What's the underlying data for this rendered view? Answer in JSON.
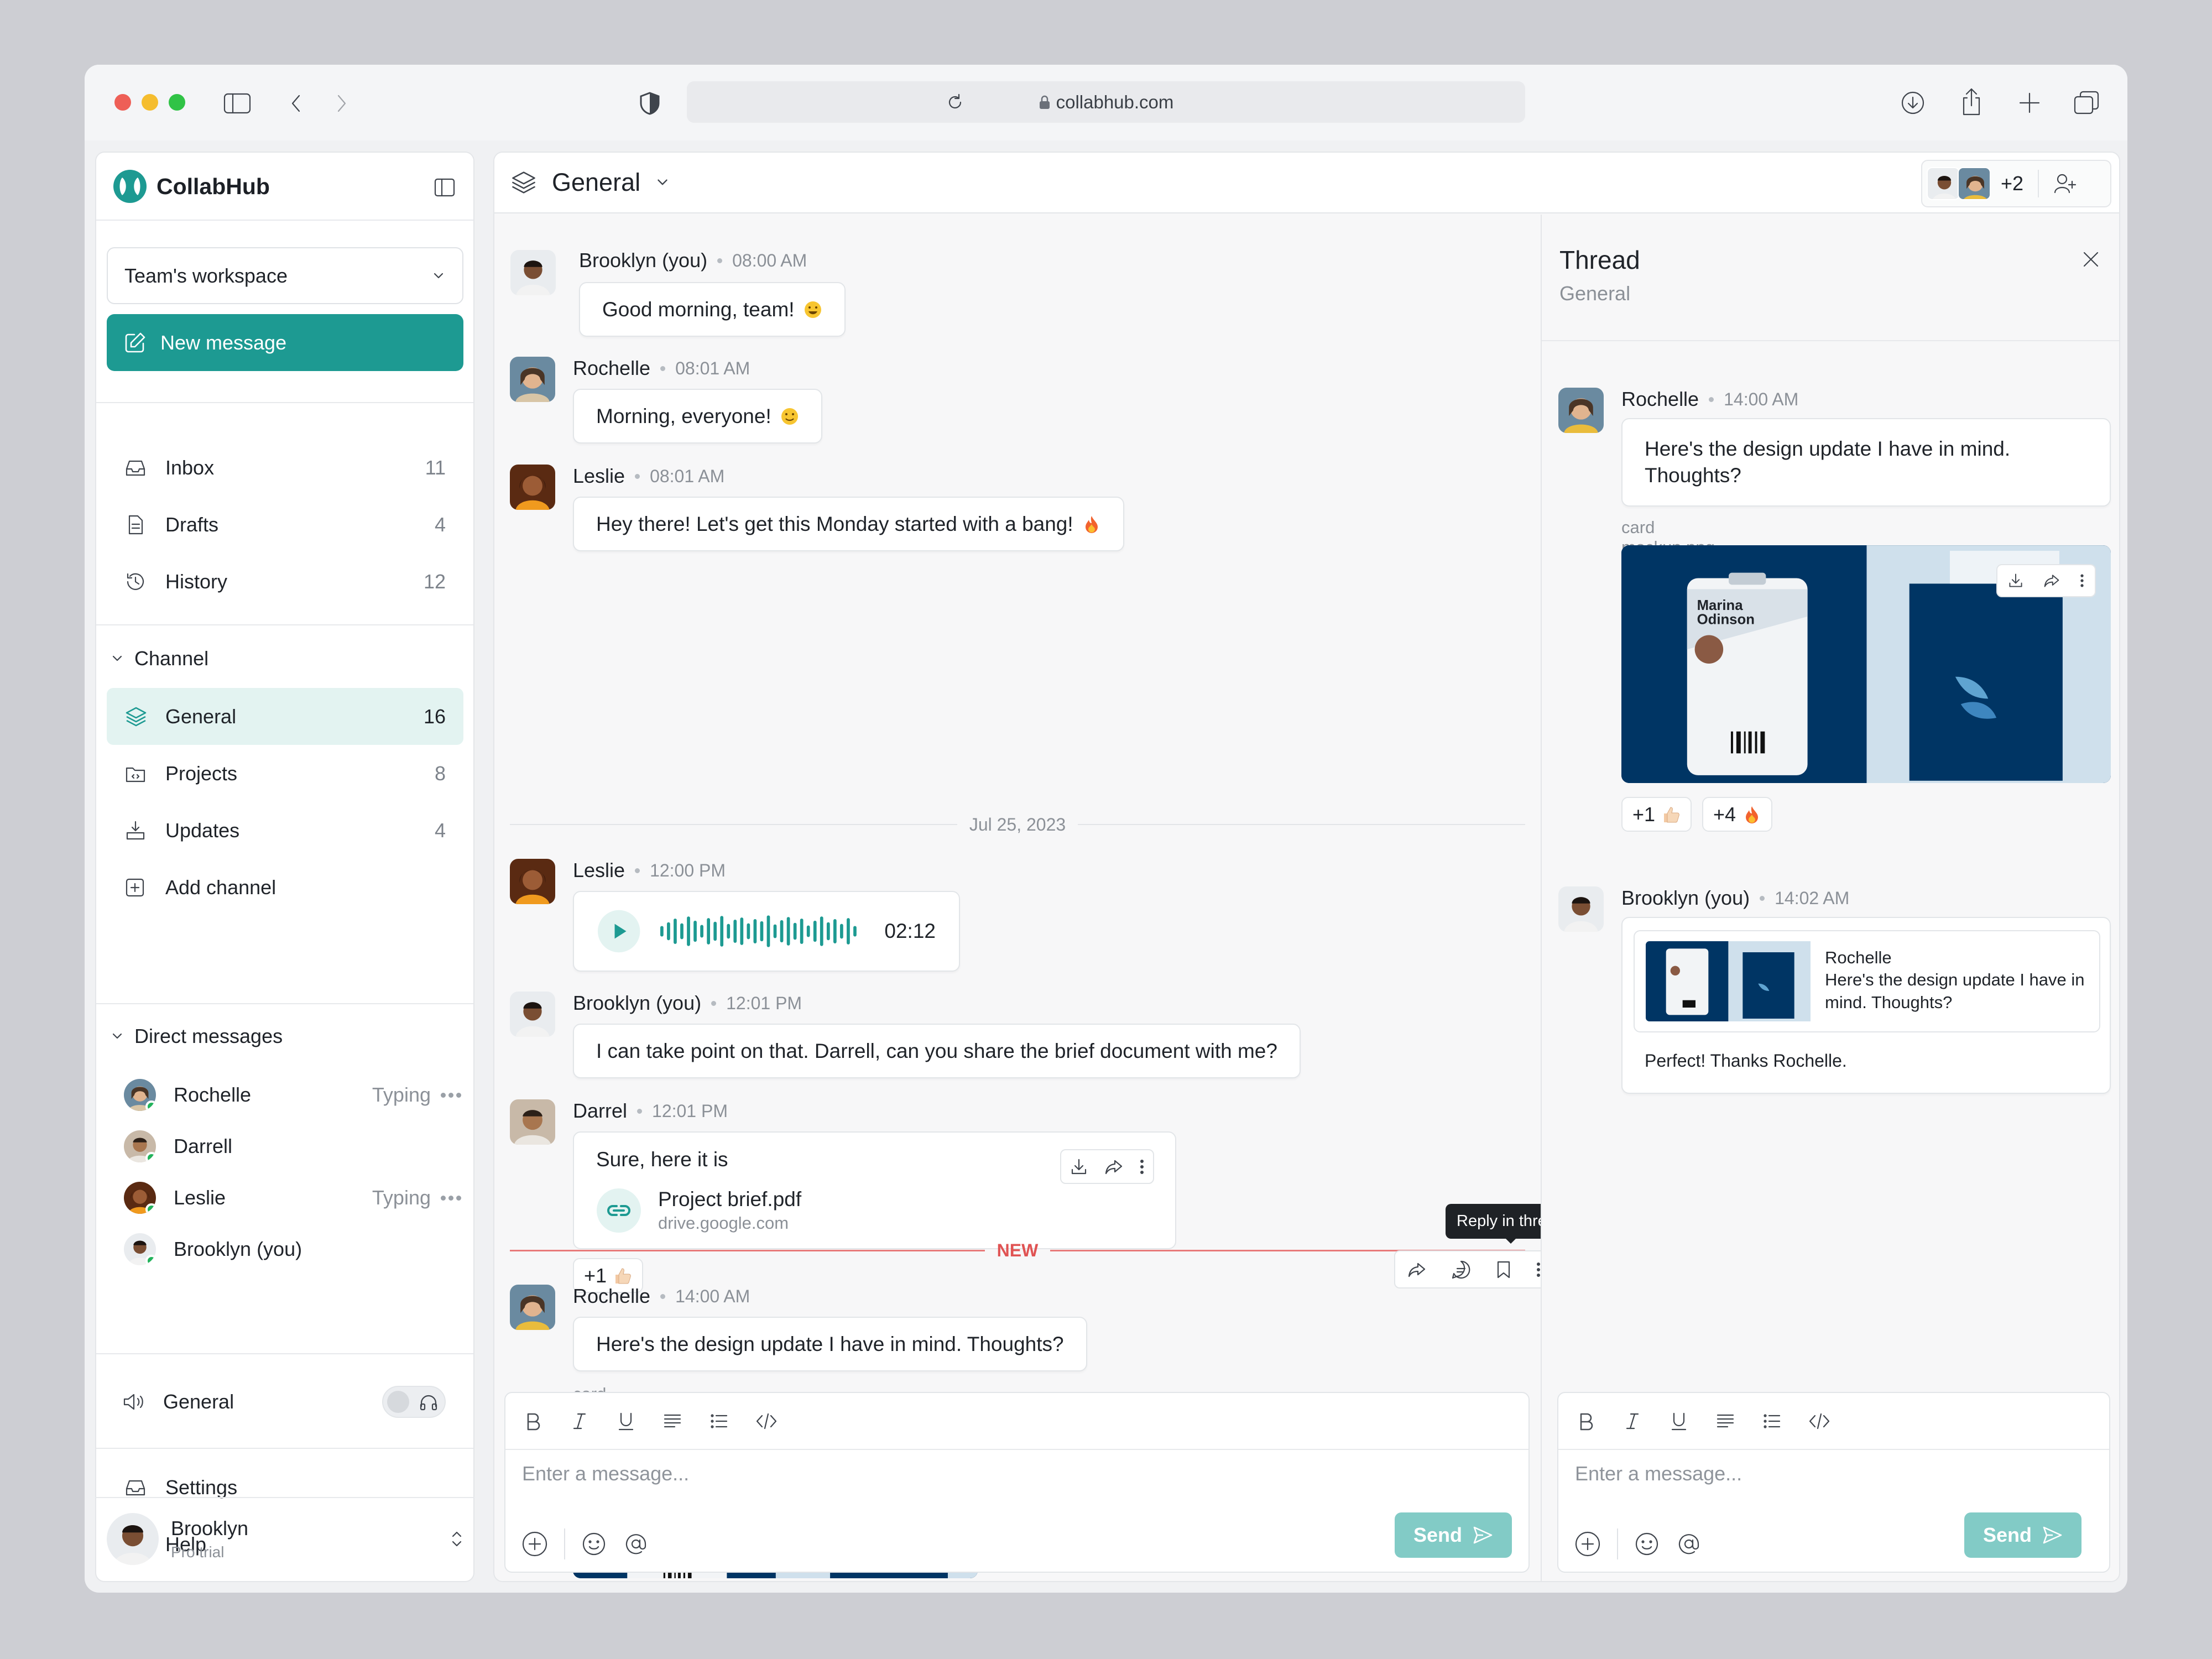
{
  "browser": {
    "url": "collabhub.com"
  },
  "app": {
    "name": "CollabHub"
  },
  "sidebar": {
    "workspace": "Team's workspace",
    "new_message": "New message",
    "nav": [
      {
        "label": "Inbox",
        "count": "11"
      },
      {
        "label": "Drafts",
        "count": "4"
      },
      {
        "label": "History",
        "count": "12"
      }
    ],
    "channel_heading": "Channel",
    "channels": [
      {
        "label": "General",
        "count": "16"
      },
      {
        "label": "Projects",
        "count": "8"
      },
      {
        "label": "Updates",
        "count": "4"
      },
      {
        "label": "Add channel",
        "count": ""
      }
    ],
    "dm_heading": "Direct messages",
    "dms": [
      {
        "name": "Rochelle",
        "status": "Typing"
      },
      {
        "name": "Darrell",
        "status": ""
      },
      {
        "name": "Leslie",
        "status": "Typing"
      },
      {
        "name": "Brooklyn (you)",
        "status": ""
      }
    ],
    "voice_channel": "General",
    "settings": "Settings",
    "help": "Help",
    "user": {
      "name": "Brooklyn",
      "plan": "Pro trial"
    }
  },
  "main": {
    "channel": "General",
    "members_extra": "+2",
    "date_separator": "Jul 25, 2023",
    "new_separator": "NEW",
    "tooltip": "Reply in thread",
    "messages": [
      {
        "author": "Brooklyn (you)",
        "time": "08:00 AM",
        "text": "Good morning, team!"
      },
      {
        "author": "Rochelle",
        "time": "08:01 AM",
        "text": "Morning, everyone!"
      },
      {
        "author": "Leslie",
        "time": "08:01 AM",
        "text": "Hey there! Let's get this Monday started with a bang!"
      },
      {
        "author": "Leslie",
        "time": "12:00 PM",
        "audio_duration": "02:12"
      },
      {
        "author": "Brooklyn (you)",
        "time": "12:01 PM",
        "text": "I can take point on that. Darrell, can you share the brief document with me?"
      },
      {
        "author": "Darrel",
        "time": "12:01 PM",
        "text": "Sure, here it is",
        "file_name": "Project brief.pdf",
        "file_source": "drive.google.com",
        "reaction": "+1"
      },
      {
        "author": "Rochelle",
        "time": "14:00 AM",
        "text": "Here's the design update I have in mind. Thoughts?",
        "attachment": "card mockup.png"
      }
    ],
    "composer": {
      "placeholder": "Enter a message...",
      "send": "Send"
    }
  },
  "thread": {
    "title": "Thread",
    "subtitle": "General",
    "root": {
      "author": "Rochelle",
      "time": "14:00 AM",
      "text": "Here's the design update I have in mind. Thoughts?",
      "attachment": "card mockup.png",
      "reactions": [
        "+1",
        "+4"
      ]
    },
    "reply": {
      "author": "Brooklyn (you)",
      "time": "14:02 AM",
      "quote_author": "Rochelle",
      "quote_text": "Here's the design update I have in mind. Thoughts?",
      "text": "Perfect! Thanks Rochelle."
    },
    "composer": {
      "placeholder": "Enter a message...",
      "send": "Send"
    }
  },
  "mockup": {
    "card_name": "Marina Odinson"
  },
  "colors": {
    "accent": "#1d9a92",
    "accent_light": "#e3f3f1",
    "new_marker": "#e05353",
    "card_navy": "#003564",
    "send_disabled": "#82cbc6"
  }
}
